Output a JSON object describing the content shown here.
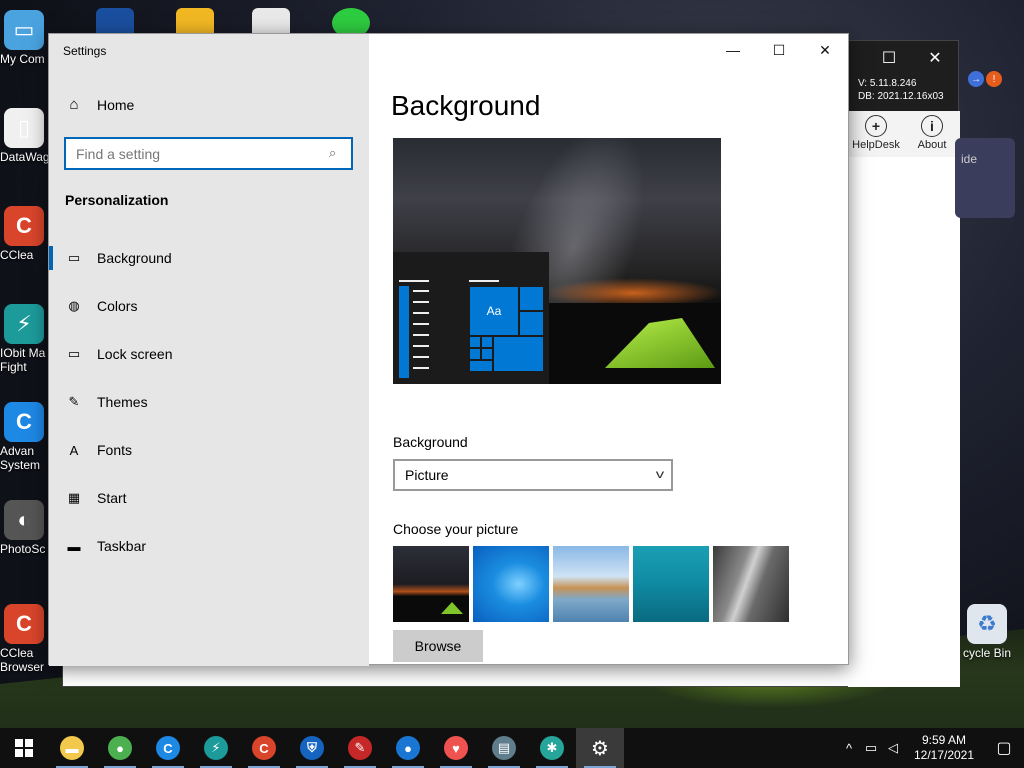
{
  "desktop": {
    "icons": [
      {
        "label": "My Com",
        "color": "#4aa3df",
        "glyph": "▭"
      },
      {
        "label": "DataWag",
        "color": "#f0f0f0",
        "glyph": "▯"
      },
      {
        "label": "CClea",
        "color": "#d9452b",
        "glyph": "C"
      },
      {
        "label": "IObit Ma Fight",
        "color": "#1d9b9b",
        "glyph": "⚡"
      },
      {
        "label": "Advan System",
        "color": "#1e88e5",
        "glyph": "C"
      },
      {
        "label": "PhotoSc",
        "color": "#555555",
        "glyph": "◐"
      },
      {
        "label": "CClea Browser",
        "color": "#d9452b",
        "glyph": "C"
      }
    ],
    "recycle_bin": "cycle Bin"
  },
  "background_app": {
    "version": "V: 5.11.8.246",
    "db": "DB: 2021.12.16x03",
    "helpdesk_label": "HelpDesk",
    "about_label": "About",
    "side_text": "ide",
    "maximize_glyph": "☐",
    "close_glyph": "✕"
  },
  "settings": {
    "title": "Settings",
    "window_controls": {
      "minimize": "—",
      "maximize": "☐",
      "close": "✕"
    },
    "home_label": "Home",
    "search_placeholder": "Find a setting",
    "section_title": "Personalization",
    "nav_items": [
      {
        "label": "Background",
        "icon": "▭"
      },
      {
        "label": "Colors",
        "icon": "◍"
      },
      {
        "label": "Lock screen",
        "icon": "▭"
      },
      {
        "label": "Themes",
        "icon": "✎"
      },
      {
        "label": "Fonts",
        "icon": "A"
      },
      {
        "label": "Start",
        "icon": "▦"
      },
      {
        "label": "Taskbar",
        "icon": "▬"
      }
    ],
    "heading": "Background",
    "preview_tile_text": "Aa",
    "background_label": "Background",
    "background_value": "Picture",
    "choose_label": "Choose your picture",
    "browse_label": "Browse",
    "accent_color": "#0078d4"
  },
  "taskbar": {
    "time": "9:59 AM",
    "date": "12/17/2021",
    "apps": [
      {
        "name": "file-explorer",
        "color": "#f2c94c",
        "glyph": "▬"
      },
      {
        "name": "chrome",
        "color": "#4caf50",
        "glyph": "●"
      },
      {
        "name": "advanced-systemcare",
        "color": "#1e88e5",
        "glyph": "C"
      },
      {
        "name": "iobit-malware-fighter",
        "color": "#1d9b9b",
        "glyph": "⚡"
      },
      {
        "name": "ccleaner",
        "color": "#d9452b",
        "glyph": "C"
      },
      {
        "name": "shield",
        "color": "#1565c0",
        "glyph": "⛨"
      },
      {
        "name": "red-app",
        "color": "#c62828",
        "glyph": "✎"
      },
      {
        "name": "ccleaner-browser",
        "color": "#1976d2",
        "glyph": "●"
      },
      {
        "name": "pocket",
        "color": "#ef5350",
        "glyph": "♥"
      },
      {
        "name": "network-app",
        "color": "#607d8b",
        "glyph": "▤"
      },
      {
        "name": "accessibility-app",
        "color": "#26a69a",
        "glyph": "✱"
      },
      {
        "name": "settings",
        "color": "#3a3a3a",
        "glyph": "⚙"
      }
    ]
  }
}
